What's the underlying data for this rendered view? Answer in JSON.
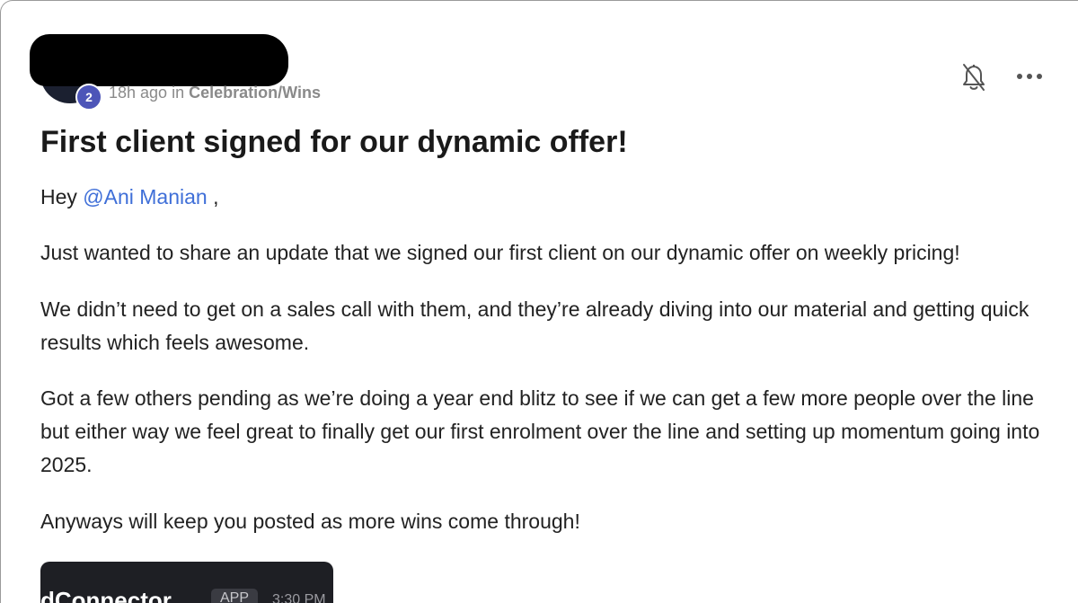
{
  "post": {
    "author_level": "2",
    "time_ago": "18h ago",
    "in_word": "in",
    "category": "Celebration/Wins",
    "title": "First client signed for our dynamic offer!",
    "greeting_prefix": "Hey ",
    "mention": "@Ani Manian",
    "greeting_suffix": " ,",
    "paragraphs": [
      "Just wanted to share an update that we signed our first client on our dynamic offer on weekly pricing!",
      "We didn’t need to get on a sales call with them, and they’re already diving into our material and getting quick results which feels awesome.",
      "Got a few others pending as we’re doing a year end blitz to see if we can get a few more people over the line but either way we feel great to finally get our first enrolment over the line and setting up momentum going into 2025.",
      "Anyways will keep you posted as more wins come through!"
    ],
    "embed": {
      "app_name": "dConnector",
      "tag": "APP",
      "time": "3:30 PM"
    }
  },
  "actions": {
    "bell_icon": "bell-off-icon",
    "more_icon": "more-horizontal-icon"
  },
  "colors": {
    "mention": "#3f6fd8",
    "level_badge": "#4d55b8",
    "meta_text": "#8a8a8a"
  }
}
